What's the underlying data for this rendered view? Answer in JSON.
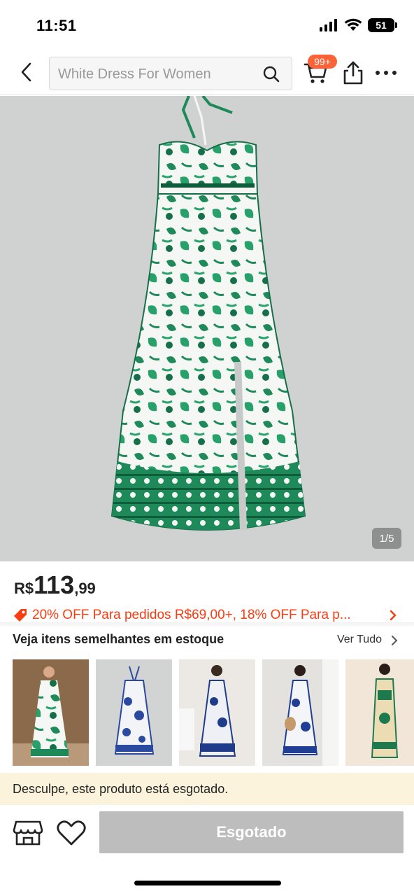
{
  "status_bar": {
    "time": "11:51",
    "battery": "51"
  },
  "nav": {
    "search_placeholder": "White Dress For Women",
    "cart_badge": "99+"
  },
  "gallery": {
    "page_indicator": "1/5"
  },
  "price": {
    "currency": "R$",
    "integer": "113",
    "decimal": ",99"
  },
  "promo": {
    "text": "20% OFF Para pedidos R$69,00+,  18% OFF Para p..."
  },
  "similar": {
    "title": "Veja itens semelhantes em estoque",
    "see_all": "Ver Tudo",
    "items": [
      {
        "name": "green-floral-dress"
      },
      {
        "name": "blue-floral-dress"
      },
      {
        "name": "blue-halter-dress"
      },
      {
        "name": "blue-print-maxi-dress"
      },
      {
        "name": "green-beige-print-dress"
      }
    ]
  },
  "soldout_banner": {
    "text": "Desculpe, este produto está esgotado."
  },
  "bottom_bar": {
    "soldout_label": "Esgotado"
  },
  "colors": {
    "accent": "#fa6338",
    "promo": "#fa3c12",
    "banner": "#fcf3dc",
    "disabled": "#bdbdbd",
    "dress_green": "#1e8a5a"
  }
}
